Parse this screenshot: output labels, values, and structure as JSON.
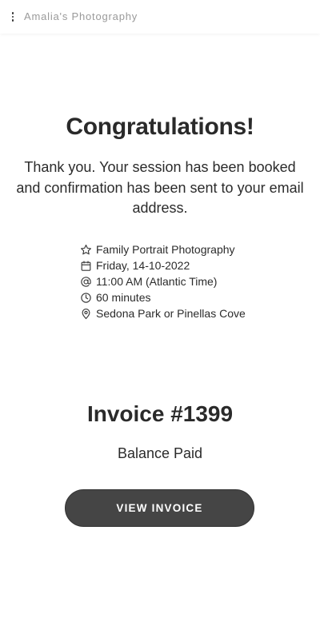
{
  "header": {
    "menu_icon": "vertical-dots-icon",
    "brand": "Amalia's Photography"
  },
  "confirmation": {
    "title": "Congratulations!",
    "message": "Thank you. Your session has been booked and confirmation has been sent to your email address."
  },
  "booking": {
    "items": [
      {
        "icon": "star-icon",
        "text": "Family Portrait Photography"
      },
      {
        "icon": "calendar-icon",
        "text": "Friday, 14-10-2022"
      },
      {
        "icon": "at-icon",
        "text": "11:00 AM (Atlantic Time)"
      },
      {
        "icon": "clock-icon",
        "text": "60 minutes"
      },
      {
        "icon": "location-pin-icon",
        "text": "Sedona Park or Pinellas Cove"
      }
    ]
  },
  "invoice": {
    "title": "Invoice #1399",
    "status": "Balance Paid",
    "button_label": "VIEW INVOICE"
  },
  "colors": {
    "button_bg": "#454545",
    "brand_text": "#9a9a9a",
    "body_text": "#2b2b2b"
  }
}
